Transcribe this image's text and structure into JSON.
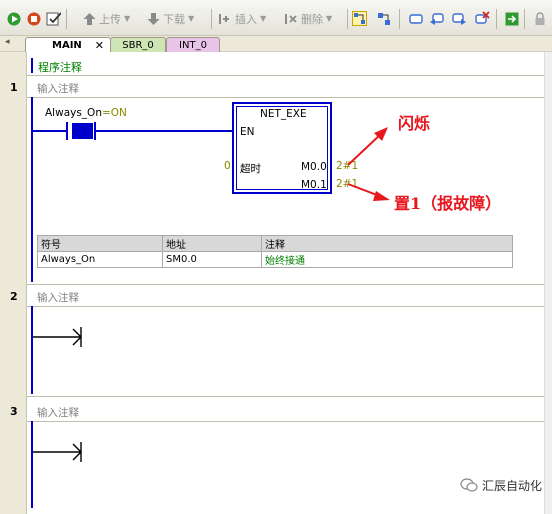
{
  "toolbar": {
    "upload_label": "上传",
    "download_label": "下载",
    "insert_label": "插入",
    "delete_label": "删除",
    "icons": [
      "run-icon",
      "stop-icon",
      "compile-icon",
      "upload-icon",
      "download-icon",
      "insert-icon",
      "delete-icon",
      "ladder-view-icon",
      "fbd-view-icon",
      "bookmark-icon",
      "prev-icon",
      "next-icon",
      "clear-icon",
      "export-icon",
      "lock-icon"
    ]
  },
  "tabs": [
    {
      "label": "MAIN",
      "active": true
    },
    {
      "label": "SBR_0",
      "active": false
    },
    {
      "label": "INT_0",
      "active": false
    }
  ],
  "program_comment": "程序注释",
  "network1": {
    "number": "1",
    "comment": "输入注释",
    "contact_name": "Always_On",
    "contact_state": "=ON",
    "block": {
      "name": "NET_EXE",
      "en": "EN",
      "timeout_value": "0",
      "timeout_label": "超时",
      "out1": "M0.0",
      "out2": "M0.1",
      "out1_value": "2#1",
      "out2_value": "2#1"
    },
    "annotation_flash": "闪烁",
    "annotation_set": "置1（报故障）",
    "symbol_table": {
      "headers": [
        "符号",
        "地址",
        "注释"
      ],
      "rows": [
        [
          "Always_On",
          "SM0.0",
          "始终接通"
        ]
      ]
    }
  },
  "network2": {
    "number": "2",
    "comment": "输入注释"
  },
  "network3": {
    "number": "3",
    "comment": "输入注释"
  },
  "watermark": "汇辰自动化",
  "colors": {
    "rail": "#0000cc",
    "annotation": "#e8161d",
    "comment_green": "#008000",
    "value_olive": "#8a8a00"
  }
}
